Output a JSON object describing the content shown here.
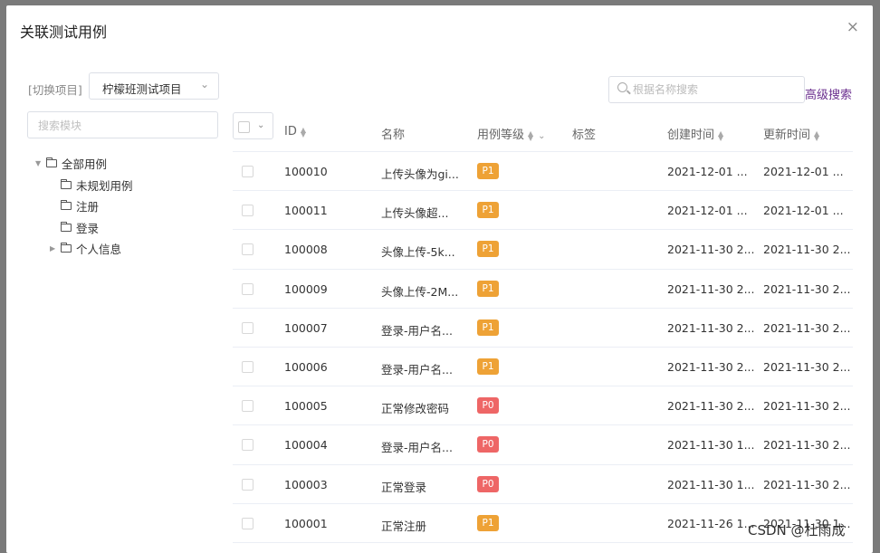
{
  "dialog": {
    "title": "关联测试用例",
    "close_symbol": "×"
  },
  "project": {
    "label": "[切换项目]",
    "selected": "柠檬班测试项目"
  },
  "search": {
    "placeholder": "根据名称搜索",
    "advanced_label": "高级搜索"
  },
  "module_search": {
    "placeholder": "搜索模块"
  },
  "tree": {
    "root": "全部用例",
    "children": [
      {
        "label": "未规划用例",
        "expandable": false
      },
      {
        "label": "注册",
        "expandable": false
      },
      {
        "label": "登录",
        "expandable": false
      },
      {
        "label": "个人信息",
        "expandable": true
      }
    ]
  },
  "table": {
    "headers": {
      "id": "ID",
      "name": "名称",
      "level": "用例等级",
      "tag": "标签",
      "created": "创建时间",
      "updated": "更新时间"
    },
    "rows": [
      {
        "id": "100010",
        "name": "上传头像为gi...",
        "level": "P1",
        "created": "2021-12-01 ...",
        "updated": "2021-12-01 ..."
      },
      {
        "id": "100011",
        "name": "上传头像超...",
        "level": "P1",
        "created": "2021-12-01 ...",
        "updated": "2021-12-01 ..."
      },
      {
        "id": "100008",
        "name": "头像上传-5k...",
        "level": "P1",
        "created": "2021-11-30 2...",
        "updated": "2021-11-30 2..."
      },
      {
        "id": "100009",
        "name": "头像上传-2M...",
        "level": "P1",
        "created": "2021-11-30 2...",
        "updated": "2021-11-30 2..."
      },
      {
        "id": "100007",
        "name": "登录-用户名...",
        "level": "P1",
        "created": "2021-11-30 2...",
        "updated": "2021-11-30 2..."
      },
      {
        "id": "100006",
        "name": "登录-用户名...",
        "level": "P1",
        "created": "2021-11-30 2...",
        "updated": "2021-11-30 2..."
      },
      {
        "id": "100005",
        "name": "正常修改密码",
        "level": "P0",
        "created": "2021-11-30 2...",
        "updated": "2021-11-30 2..."
      },
      {
        "id": "100004",
        "name": "登录-用户名...",
        "level": "P0",
        "created": "2021-11-30 1...",
        "updated": "2021-11-30 2..."
      },
      {
        "id": "100003",
        "name": "正常登录",
        "level": "P0",
        "created": "2021-11-30 1...",
        "updated": "2021-11-30 2..."
      },
      {
        "id": "100001",
        "name": "正常注册",
        "level": "P1",
        "created": "2021-11-26 1...",
        "updated": "2021-11-30 1..."
      }
    ]
  },
  "watermark": "CSDN @杜雨成",
  "colors": {
    "p1": "#eea236",
    "p0": "#ee6666",
    "link": "#6b2f8f"
  }
}
